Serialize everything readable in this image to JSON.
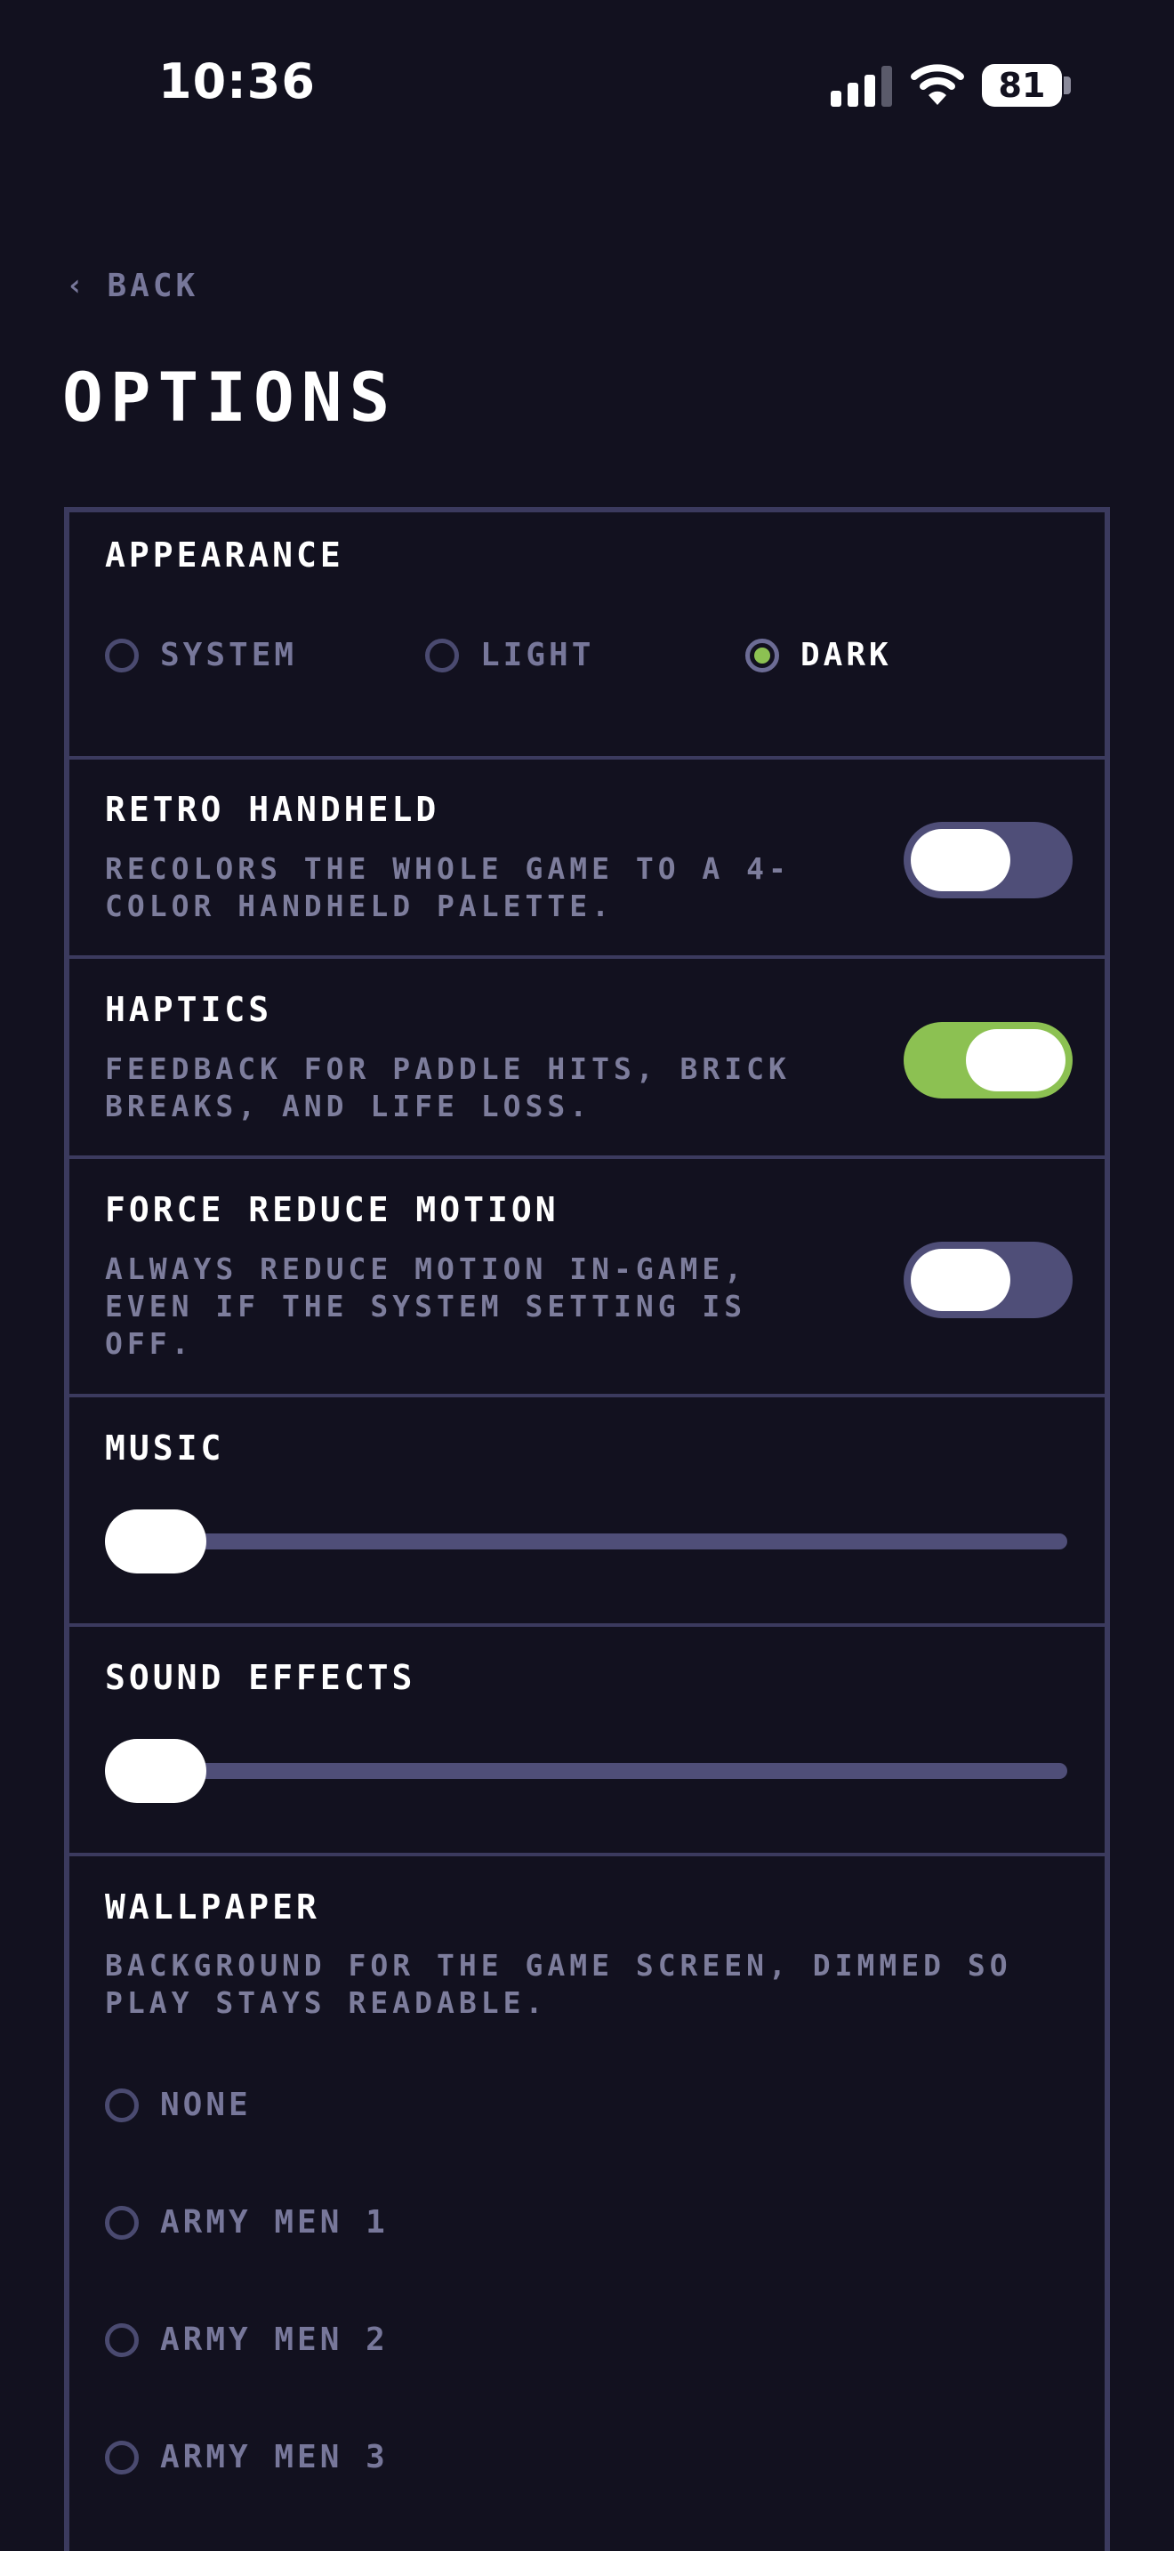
{
  "status_bar": {
    "time": "10:36",
    "battery": "81",
    "icons": [
      "cellular-signal-icon",
      "wifi-icon",
      "battery-icon"
    ]
  },
  "nav": {
    "back_chevron": "‹",
    "back_label": "BACK",
    "title": "OPTIONS"
  },
  "appearance": {
    "title": "APPEARANCE",
    "options": [
      {
        "label": "SYSTEM",
        "selected": false
      },
      {
        "label": "LIGHT",
        "selected": false
      },
      {
        "label": "DARK",
        "selected": true
      }
    ]
  },
  "retro_handheld": {
    "title": "RETRO HANDHELD",
    "description": "RECOLORS THE WHOLE GAME TO A 4-COLOR HANDHELD PALETTE.",
    "enabled": false
  },
  "haptics": {
    "title": "HAPTICS",
    "description": "FEEDBACK FOR PADDLE HITS, BRICK BREAKS, AND LIFE LOSS.",
    "enabled": true
  },
  "force_reduce_motion": {
    "title": "FORCE REDUCE MOTION",
    "description": "ALWAYS REDUCE MOTION IN-GAME, EVEN IF THE SYSTEM SETTING IS OFF.",
    "enabled": false
  },
  "music": {
    "title": "MUSIC",
    "level": 0
  },
  "sound_effects": {
    "title": "SOUND EFFECTS",
    "level": 0
  },
  "wallpaper": {
    "title": "WALLPAPER",
    "description": "BACKGROUND FOR THE GAME SCREEN, DIMMED SO PLAY STAYS READABLE.",
    "options": [
      {
        "label": "NONE",
        "selected": false
      },
      {
        "label": "ARMY MEN 1",
        "selected": false
      },
      {
        "label": "ARMY MEN 2",
        "selected": false
      },
      {
        "label": "ARMY MEN 3",
        "selected": false
      }
    ]
  },
  "colors": {
    "background": "#12111f",
    "border": "#3b3a5e",
    "muted_text": "#7d7d9c",
    "toggle_off": "#4f4e78",
    "accent_green": "#8cc152"
  }
}
